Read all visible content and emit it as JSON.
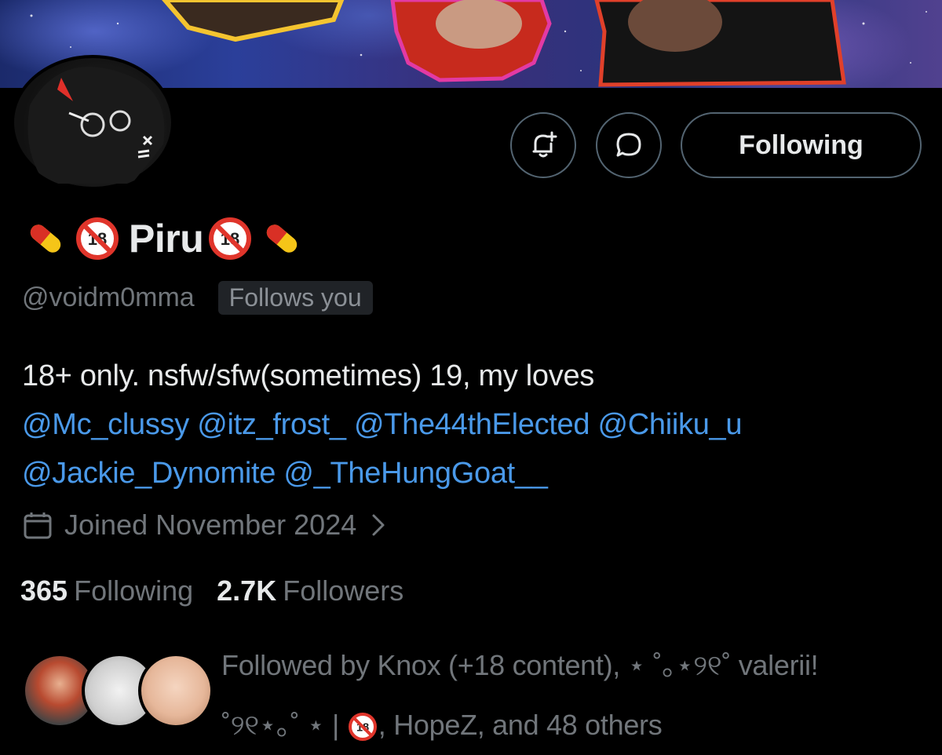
{
  "profile": {
    "display_name": "Piru",
    "handle": "@voidm0mma",
    "follows_you_badge": "Follows you"
  },
  "actions": {
    "notify_icon": "bell-plus-icon",
    "message_icon": "chat-bubble-icon",
    "following_label": "Following"
  },
  "bio": {
    "text": "18+ only. nsfw/sfw(sometimes) 19, my loves",
    "mentions": [
      "@Mc_clussy",
      "@itz_frost_",
      "@The44thElected",
      "@Chiiku_u",
      "@Jackie_Dynomite",
      "@_TheHungGoat__"
    ]
  },
  "joined": {
    "icon": "calendar-icon",
    "text": "Joined November 2024",
    "chevron": "chevron-right-icon"
  },
  "stats": {
    "following_count": "365",
    "following_label": "Following",
    "followers_count": "2.7K",
    "followers_label": "Followers"
  },
  "followed_by": {
    "line1": "Followed by Knox (+18 content), ⋆ ˚｡⋆୨୧˚ valerii!",
    "line2_prefix": "˚୨୧⋆｡˚ ⋆ |",
    "line2_suffix": ", HopeZ, and 48 others"
  },
  "colors": {
    "background": "#000000",
    "text_primary": "#e7e9ea",
    "text_secondary": "#71767b",
    "link": "#4a99e9",
    "border": "#536471"
  }
}
